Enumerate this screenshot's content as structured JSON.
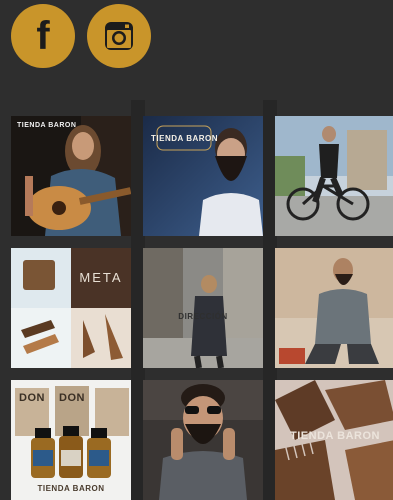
{
  "social": {
    "facebook_label": "f",
    "instagram_icon": "instagram-icon",
    "accent": "#c9952a"
  },
  "gallery": {
    "tiles": [
      {
        "caption": "TIENDA BARON"
      },
      {
        "caption": "TIENDA BARON"
      },
      {
        "caption": ""
      },
      {
        "caption": "META"
      },
      {
        "caption": "DIRECCIÓN"
      },
      {
        "caption": ""
      },
      {
        "caption": "DON",
        "caption2": "DON",
        "caption3": "TIENDA BARON"
      },
      {
        "caption": ""
      },
      {
        "caption": "TIENDA BARON"
      }
    ]
  }
}
